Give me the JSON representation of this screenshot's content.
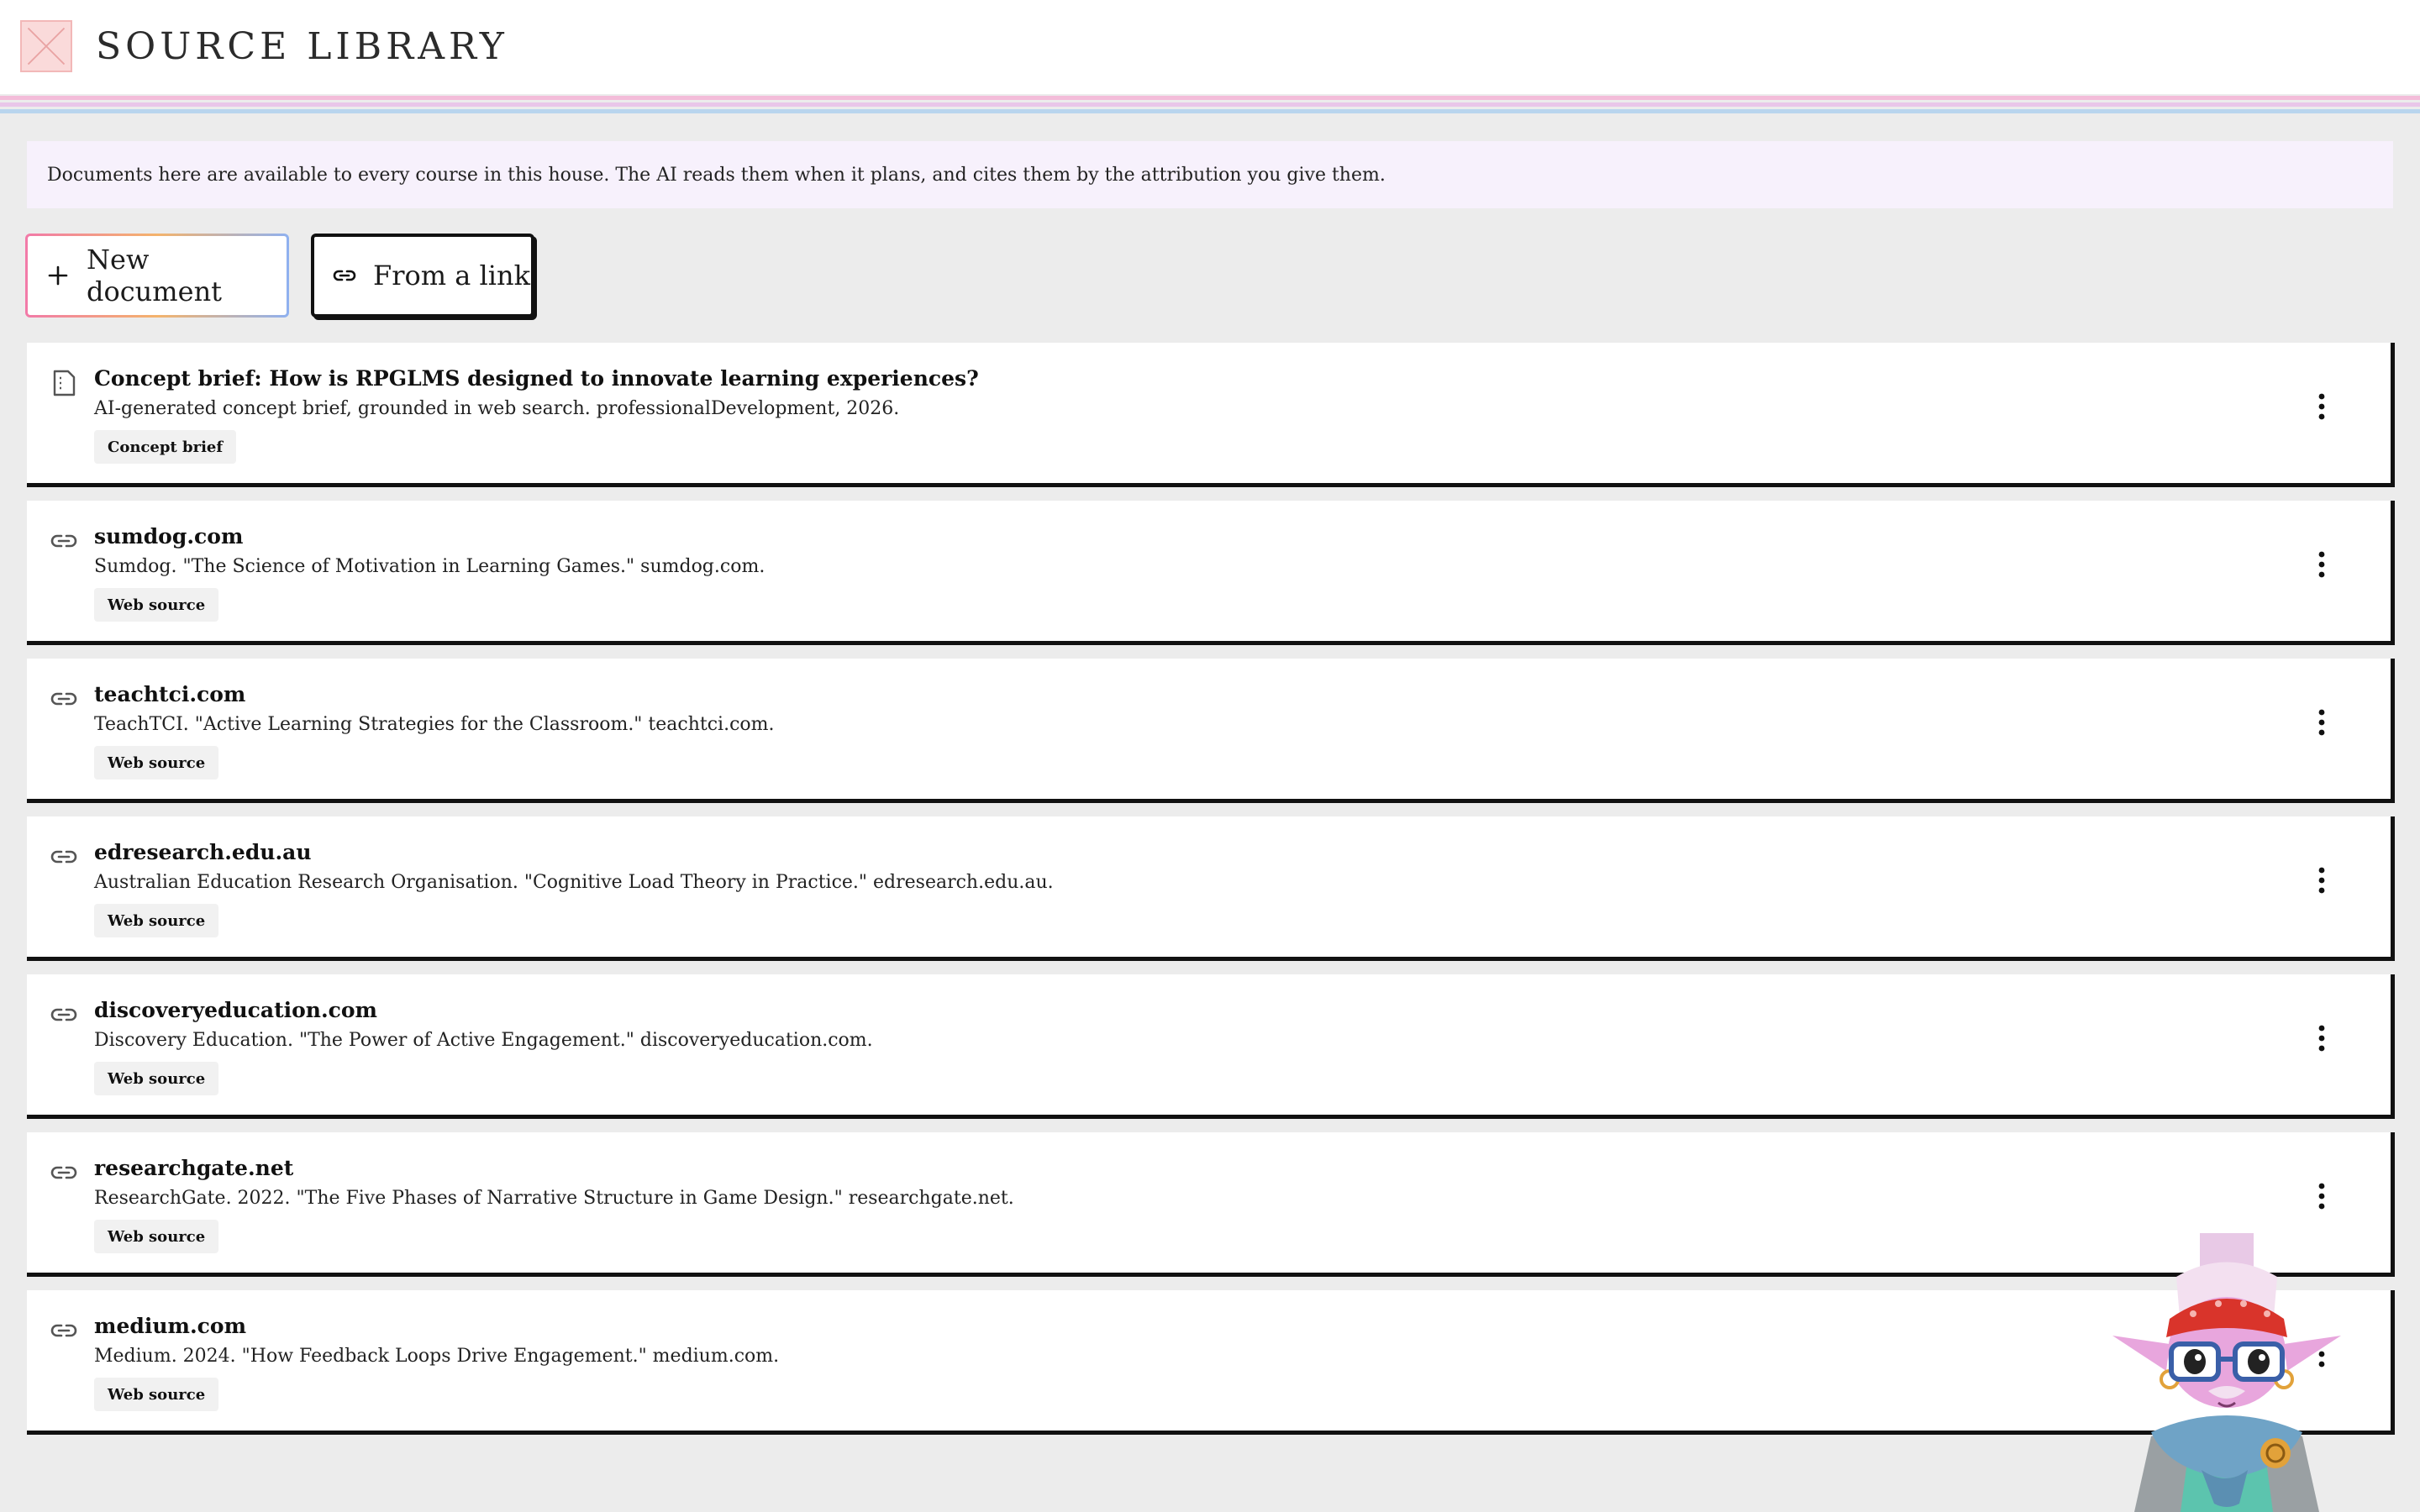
{
  "header": {
    "title": "SOURCE LIBRARY",
    "logo_icon": "logo-icon"
  },
  "notice": {
    "text": "Documents here are available to every course in this house. The AI reads them when it plans, and cites them by the attribution you give them."
  },
  "actions": {
    "new_document_label": "New document",
    "from_link_label": "From a link"
  },
  "documents": [
    {
      "icon": "document-icon",
      "title": "Concept brief: How is RPGLMS designed to innovate learning experiences?",
      "citation": "AI-generated concept brief, grounded in web search. professionalDevelopment, 2026.",
      "badge": "Concept brief"
    },
    {
      "icon": "link-icon",
      "title": "sumdog.com",
      "citation": "Sumdog. \"The Science of Motivation in Learning Games.\" sumdog.com.",
      "badge": "Web source"
    },
    {
      "icon": "link-icon",
      "title": "teachtci.com",
      "citation": "TeachTCI. \"Active Learning Strategies for the Classroom.\" teachtci.com.",
      "badge": "Web source"
    },
    {
      "icon": "link-icon",
      "title": "edresearch.edu.au",
      "citation": "Australian Education Research Organisation. \"Cognitive Load Theory in Practice.\" edresearch.edu.au.",
      "badge": "Web source"
    },
    {
      "icon": "link-icon",
      "title": "discoveryeducation.com",
      "citation": "Discovery Education. \"The Power of Active Engagement.\" discoveryeducation.com.",
      "badge": "Web source"
    },
    {
      "icon": "link-icon",
      "title": "researchgate.net",
      "citation": "ResearchGate. 2022. \"The Five Phases of Narrative Structure in Game Design.\" researchgate.net.",
      "badge": "Web source"
    },
    {
      "icon": "link-icon",
      "title": "medium.com",
      "citation": "Medium. 2024. \"How Feedback Loops Drive Engagement.\" medium.com.",
      "badge": "Web source"
    }
  ],
  "colors": {
    "background": "#ececec",
    "notice_bg": "#f7f1fc",
    "stripe_pink": "#f3bcd9",
    "stripe_lilac": "#e9c6e9",
    "stripe_blue": "#b9d5ee"
  }
}
